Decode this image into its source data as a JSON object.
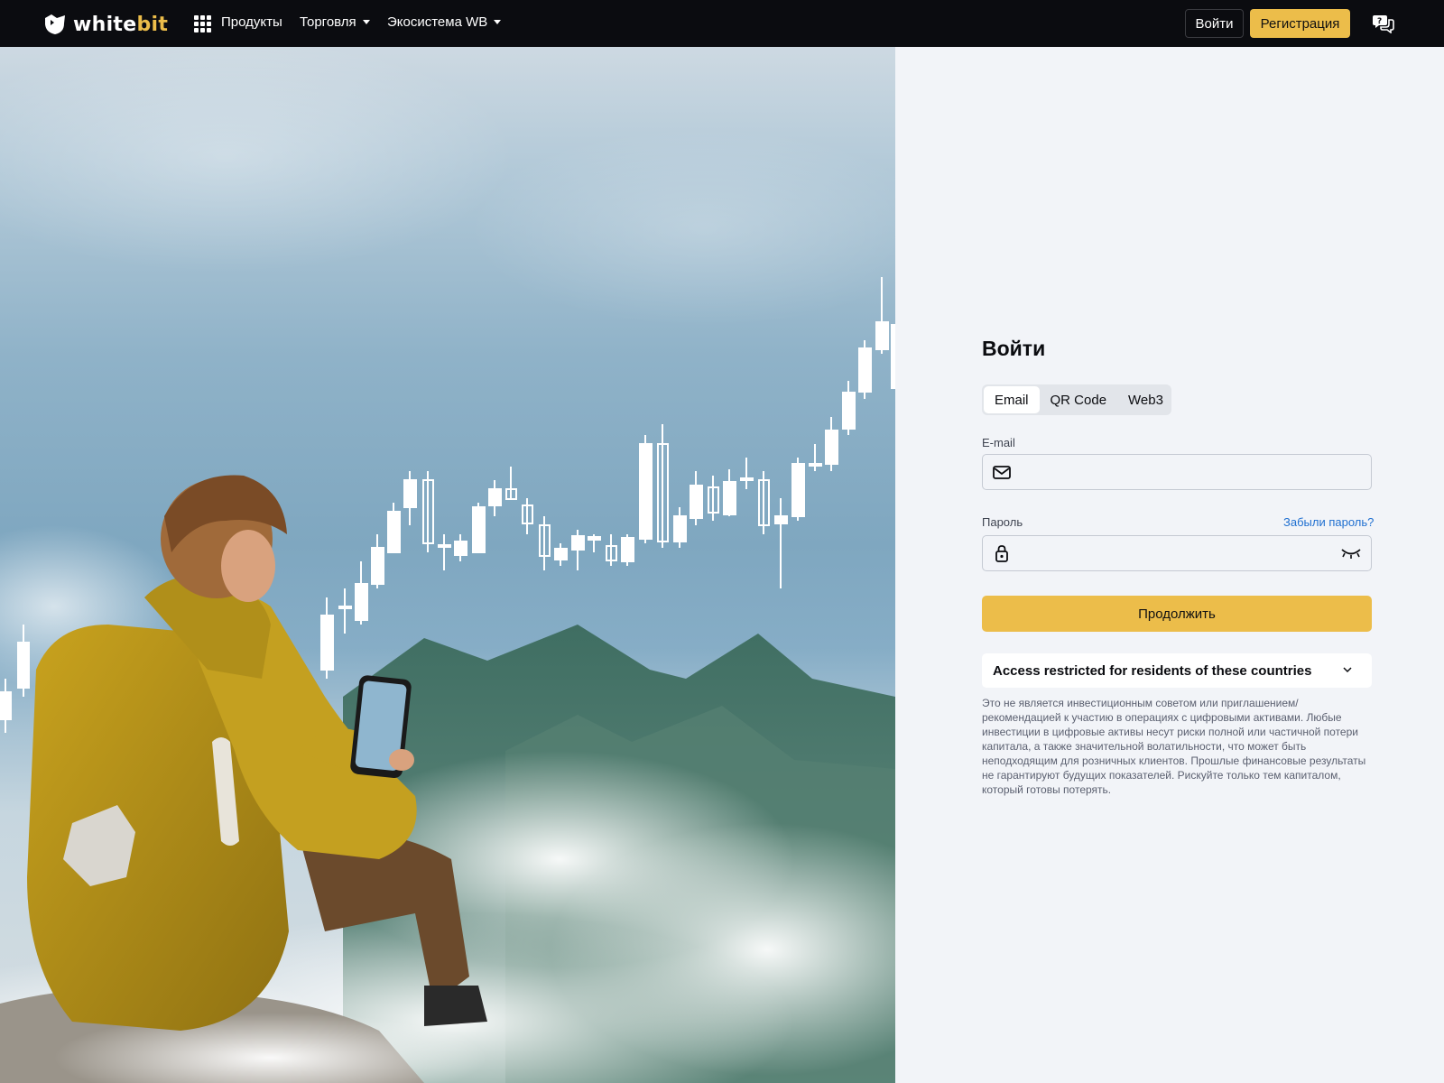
{
  "header": {
    "logo_text_part1": "white",
    "logo_text_part2": "bit",
    "nav": [
      {
        "label": "Продукты"
      },
      {
        "label": "Торговля"
      },
      {
        "label": "Экосистема WB"
      }
    ],
    "login_label": "Войти",
    "register_label": "Регистрация"
  },
  "login": {
    "title": "Войти",
    "tabs": [
      {
        "label": "Email",
        "active": true
      },
      {
        "label": "QR Code",
        "active": false
      },
      {
        "label": "Web3",
        "active": false
      }
    ],
    "email_label": "E-mail",
    "email_value": "",
    "password_label": "Пароль",
    "password_value": "",
    "forgot_label": "Забыли пароль?",
    "continue_label": "Продолжить",
    "restricted_label": "Access restricted for residents of these countries",
    "disclaimer": "Это не является инвестиционным советом или приглашением/рекомендацией к участию в операциях с цифровыми активами. Любые инвестиции в цифровые активы несут риски полной или частичной потери капитала, а также значительной волатильности, что может быть неподходящим для розничных клиентов. Прошлые финансовые результаты не гарантируют будущих показателей. Рискуйте только тем капиталом, который готовы потерять."
  },
  "colors": {
    "accent": "#ecbd4a",
    "header_bg": "#0b0c10",
    "link": "#1f6fd0",
    "panel_bg": "#f2f4f8"
  },
  "icons": {
    "nav_products": "grid-icon",
    "support": "chat-question-icon",
    "email_field": "envelope-icon",
    "password_field": "lock-icon",
    "password_toggle": "eye-closed-icon",
    "restricted_toggle": "chevron-down-icon"
  }
}
